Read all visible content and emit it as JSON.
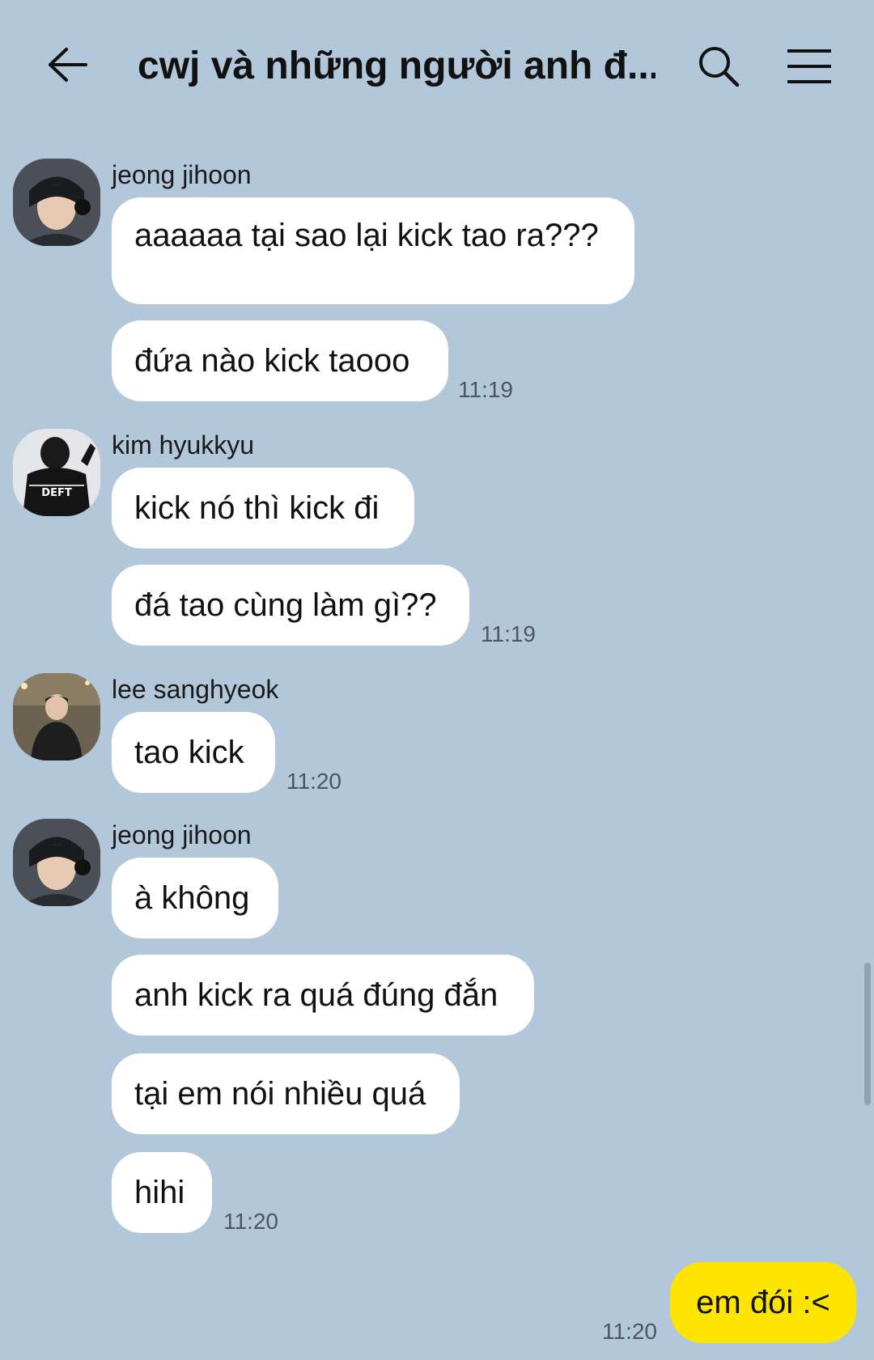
{
  "header": {
    "title": "cwj và những người anh đ...",
    "back_icon": "arrow-left-icon",
    "search_icon": "search-icon",
    "menu_icon": "hamburger-menu-icon"
  },
  "colors": {
    "background": "#b2c7d9",
    "incoming_bubble": "#ffffff",
    "outgoing_bubble": "#fee500"
  },
  "groups": [
    {
      "sender": "jeong jihoon",
      "avatar_icon": "user-avatar-jihoon",
      "messages": [
        "aaaaaa tại sao lại kick tao ra???",
        "đứa nào kick taooo"
      ],
      "time": "11:19"
    },
    {
      "sender": "kim hyukkyu",
      "avatar_icon": "user-avatar-hyukkyu",
      "avatar_text": "DEFT",
      "messages": [
        "kick nó thì kick đi",
        "đá tao cùng làm gì??"
      ],
      "time": "11:19"
    },
    {
      "sender": "lee sanghyeok",
      "avatar_icon": "user-avatar-sanghyeok",
      "messages": [
        "tao kick"
      ],
      "time": "11:20"
    },
    {
      "sender": "jeong jihoon",
      "avatar_icon": "user-avatar-jihoon",
      "messages": [
        "à không",
        "anh kick ra quá đúng đắn",
        "tại em nói nhiều quá",
        "hihi"
      ],
      "time": "11:20"
    }
  ],
  "my_message": {
    "text": "em đói :<",
    "time": "11:20"
  }
}
